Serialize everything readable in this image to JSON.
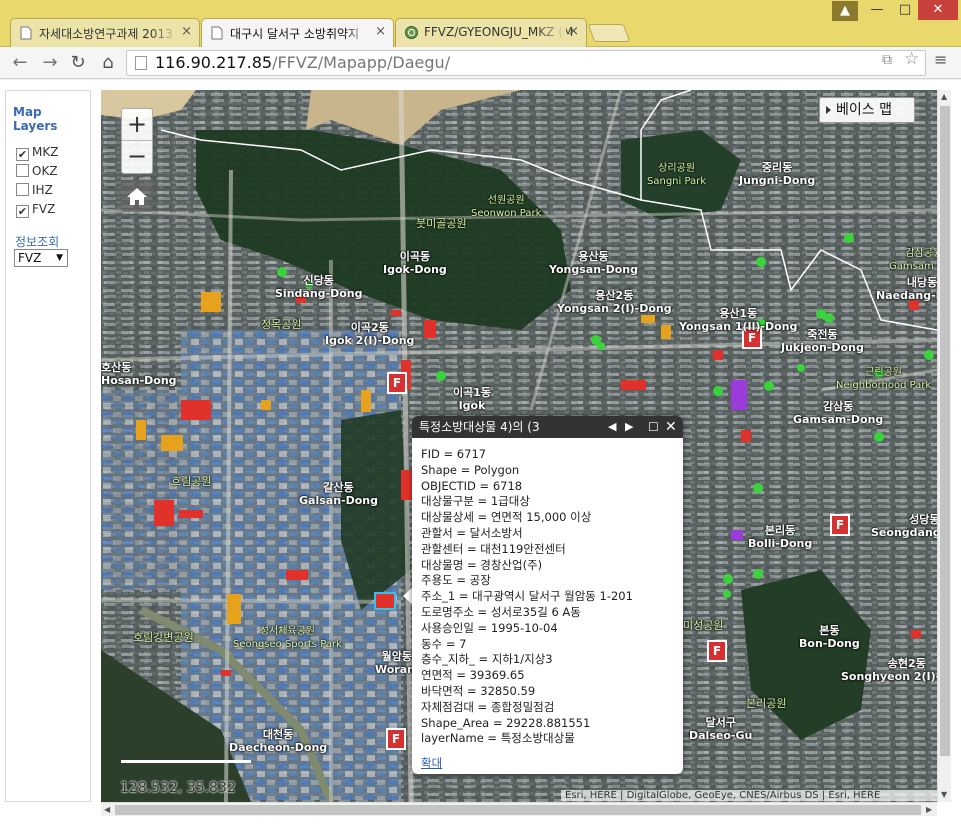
{
  "browser": {
    "tabs": [
      {
        "title": "자세대소방연구과제 2013",
        "active": false
      },
      {
        "title": "대구시 달서구 소방취약지",
        "active": true
      },
      {
        "title": "FFVZ/GYEONGJU_MKZ (M",
        "active": false
      }
    ],
    "url_host": "116.90.217.85",
    "url_path": "/FFVZ/Mapapp/Daegu/",
    "colors": {
      "frame": "#e9d86b",
      "close": "#c8423b"
    }
  },
  "sidebar": {
    "title": "Map Layers",
    "layers": [
      {
        "label": "MKZ",
        "checked": true
      },
      {
        "label": "OKZ",
        "checked": false
      },
      {
        "label": "IHZ",
        "checked": false
      },
      {
        "label": "FVZ",
        "checked": true
      }
    ],
    "info_label": "정보조회",
    "info_select": "FVZ"
  },
  "map": {
    "zoom_in": "+",
    "zoom_out": "−",
    "basemap_button": "베이스 맵",
    "coordinates": "128.532, 35.832",
    "attribution": "Esri, HERE | DigitalGlobe, GeoEye, CNES/Airbus DS | Esri, HERE",
    "labels": [
      {
        "name": "선원공원",
        "sub": "Seonwon Park",
        "kind": "park"
      },
      {
        "name": "상리공원",
        "sub": "Sangni Park",
        "kind": "park"
      },
      {
        "name": "중리동",
        "sub": "Jungni-Dong",
        "kind": "district"
      },
      {
        "name": "붓미골공원",
        "sub": "",
        "kind": "park"
      },
      {
        "name": "이곡동",
        "sub": "Igok-Dong",
        "kind": "district"
      },
      {
        "name": "신당동",
        "sub": "Sindang-Dong",
        "kind": "district"
      },
      {
        "name": "용산동",
        "sub": "Yongsan-Dong",
        "kind": "district"
      },
      {
        "name": "감삼공원",
        "sub": "Gamsam Park",
        "kind": "park"
      },
      {
        "name": "내당동",
        "sub": "Naedang-Dong",
        "kind": "district"
      },
      {
        "name": "용산2동",
        "sub": "Yongsan 2(I)-Dong",
        "kind": "district"
      },
      {
        "name": "정목공원",
        "sub": "",
        "kind": "park"
      },
      {
        "name": "이곡2동",
        "sub": "Igok 2(I)-Dong",
        "kind": "district"
      },
      {
        "name": "용산1동",
        "sub": "Yongsan 1(Il)-Dong",
        "kind": "district"
      },
      {
        "name": "죽전동",
        "sub": "Jukjeon-Dong",
        "kind": "district"
      },
      {
        "name": "호산동",
        "sub": "Hosan-Dong",
        "kind": "district"
      },
      {
        "name": "이곡1동",
        "sub": "Igok",
        "kind": "district"
      },
      {
        "name": "근린공원",
        "sub": "Neighborhood Park",
        "kind": "park"
      },
      {
        "name": "감삼동",
        "sub": "Gamsam-Dong",
        "kind": "district"
      },
      {
        "name": "흐림공원",
        "sub": "",
        "kind": "park"
      },
      {
        "name": "갈산동",
        "sub": "Galsan-Dong",
        "kind": "district"
      },
      {
        "name": "본리동",
        "sub": "Bolli-Dong",
        "kind": "district"
      },
      {
        "name": "성당동",
        "sub": "Seongdang-Dong",
        "kind": "district"
      },
      {
        "name": "호림강변공원",
        "sub": "",
        "kind": "park"
      },
      {
        "name": "성서체육공원",
        "sub": "Seongseo Sports Park",
        "kind": "park"
      },
      {
        "name": "월암동",
        "sub": "Woram",
        "kind": "district"
      },
      {
        "name": "미성공원",
        "sub": "",
        "kind": "park"
      },
      {
        "name": "본동",
        "sub": "Bon-Dong",
        "kind": "district"
      },
      {
        "name": "송현2동",
        "sub": "Songhyeon 2(I)-Dong",
        "kind": "district"
      },
      {
        "name": "본리공원",
        "sub": "",
        "kind": "park"
      },
      {
        "name": "달서구",
        "sub": "Dalseo-Gu",
        "kind": "district"
      },
      {
        "name": "대천동",
        "sub": "Daecheon-Dong",
        "kind": "district"
      }
    ]
  },
  "popup": {
    "title": "특정소방대상물 4)의 (3",
    "fields": [
      "FID = 6717",
      "Shape = Polygon",
      "OBJECTID = 6718",
      "대상물구분 = 1급대상",
      "대상물상세 = 연면적 15,000 이상",
      "관할서 = 달서소방서",
      "관할센터 = 대천119안전센터",
      "대상물명 = 경창산업(주)",
      "주용도 = 공장",
      "주소_1 = 대구광역시 달서구 월암동 1-201",
      "도로명주소 = 성서로35길 6 A동",
      "사용승인일 = 1995-10-04",
      "동수 = 7",
      "층수_지하_ = 지하1/지상3",
      "연면적 = 39369.65",
      "바닥면적 = 32850.59",
      "자체점검대 = 종합정밀점검",
      "Shape_Area = 29228.881551",
      "layerName = 특정소방대상물"
    ],
    "zoom_link": "확대"
  }
}
